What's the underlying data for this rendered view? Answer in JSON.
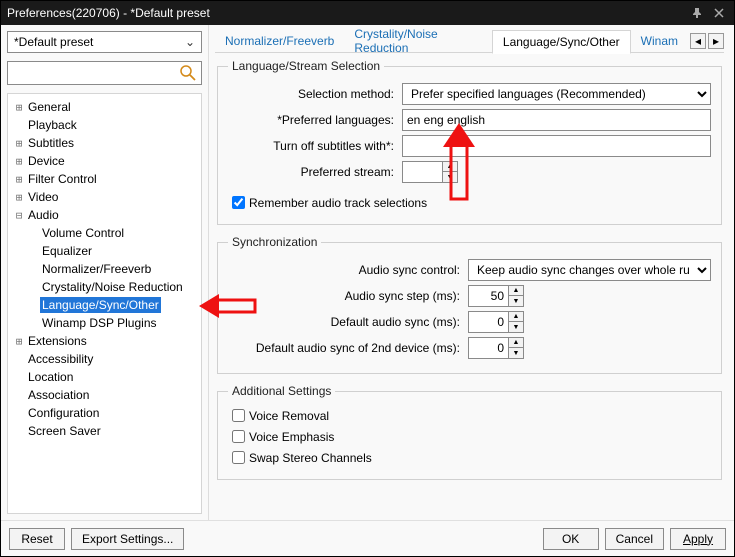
{
  "window": {
    "title": "Preferences(220706) - *Default preset"
  },
  "leftpane": {
    "preset_value": "*Default preset",
    "search_placeholder": "",
    "tree": {
      "items": [
        {
          "label": "General",
          "exp": "+"
        },
        {
          "label": "Playback",
          "exp": ""
        },
        {
          "label": "Subtitles",
          "exp": "+"
        },
        {
          "label": "Device",
          "exp": "+"
        },
        {
          "label": "Filter Control",
          "exp": "+"
        },
        {
          "label": "Video",
          "exp": "+"
        },
        {
          "label": "Audio",
          "exp": "-",
          "expanded": true,
          "children": [
            {
              "label": "Volume Control"
            },
            {
              "label": "Equalizer"
            },
            {
              "label": "Normalizer/Freeverb"
            },
            {
              "label": "Crystality/Noise Reduction"
            },
            {
              "label": "Language/Sync/Other",
              "selected": true
            },
            {
              "label": "Winamp DSP Plugins"
            }
          ]
        },
        {
          "label": "Extensions",
          "exp": "+"
        },
        {
          "label": "Accessibility",
          "exp": ""
        },
        {
          "label": "Location",
          "exp": ""
        },
        {
          "label": "Association",
          "exp": ""
        },
        {
          "label": "Configuration",
          "exp": ""
        },
        {
          "label": "Screen Saver",
          "exp": ""
        }
      ]
    }
  },
  "tabs": {
    "items": [
      {
        "label": "Normalizer/Freeverb"
      },
      {
        "label": "Crystality/Noise Reduction"
      },
      {
        "label": "Language/Sync/Other",
        "active": true
      },
      {
        "label": "Winam"
      }
    ]
  },
  "lang_group": {
    "legend": "Language/Stream Selection",
    "selection_method_label": "Selection method:",
    "selection_method_value": "Prefer specified languages (Recommended)",
    "preferred_lang_label": "*Preferred languages:",
    "preferred_lang_value": "en eng english",
    "turnoff_label": "Turn off subtitles with*:",
    "turnoff_value": "",
    "pref_stream_label": "Preferred stream:",
    "pref_stream_value": "",
    "remember_label": "Remember audio track selections",
    "remember_checked": true
  },
  "sync_group": {
    "legend": "Synchronization",
    "audio_sync_control_label": "Audio sync control:",
    "audio_sync_control_value": "Keep audio sync changes over whole ru",
    "audio_sync_step_label": "Audio sync step (ms):",
    "audio_sync_step_value": "50",
    "default_audio_sync_label": "Default audio sync (ms):",
    "default_audio_sync_value": "0",
    "default_audio_sync2_label": "Default audio sync of 2nd device (ms):",
    "default_audio_sync2_value": "0"
  },
  "addl_group": {
    "legend": "Additional Settings",
    "voice_removal": "Voice Removal",
    "voice_emphasis": "Voice Emphasis",
    "swap_stereo": "Swap Stereo Channels"
  },
  "buttons": {
    "reset": "Reset",
    "export": "Export Settings...",
    "ok": "OK",
    "cancel": "Cancel",
    "apply": "Apply"
  }
}
